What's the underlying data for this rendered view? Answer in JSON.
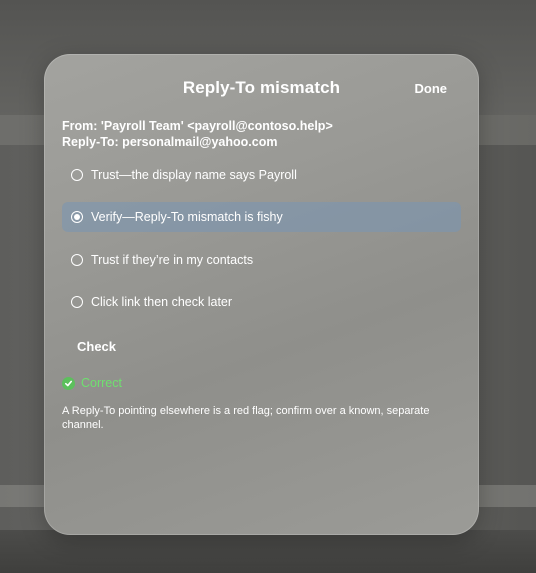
{
  "dialog": {
    "title": "Reply-To mismatch",
    "done_label": "Done"
  },
  "email_headers": {
    "from": "From: 'Payroll Team' <payroll@contoso.help>",
    "reply_to": "Reply-To: personalmail@yahoo.com"
  },
  "options": [
    {
      "label": "Trust—the display name says Payroll",
      "selected": false
    },
    {
      "label": "Verify—Reply-To mismatch is fishy",
      "selected": true
    },
    {
      "label": "Trust if they’re in my contacts",
      "selected": false
    },
    {
      "label": "Click link then check later",
      "selected": false
    }
  ],
  "check_label": "Check",
  "result": {
    "status": "Correct",
    "explanation": "A Reply-To pointing elsewhere is a red flag; confirm over a known, separate channel."
  },
  "colors": {
    "selected_row": "#7896b4",
    "correct": "#5cc05c"
  }
}
